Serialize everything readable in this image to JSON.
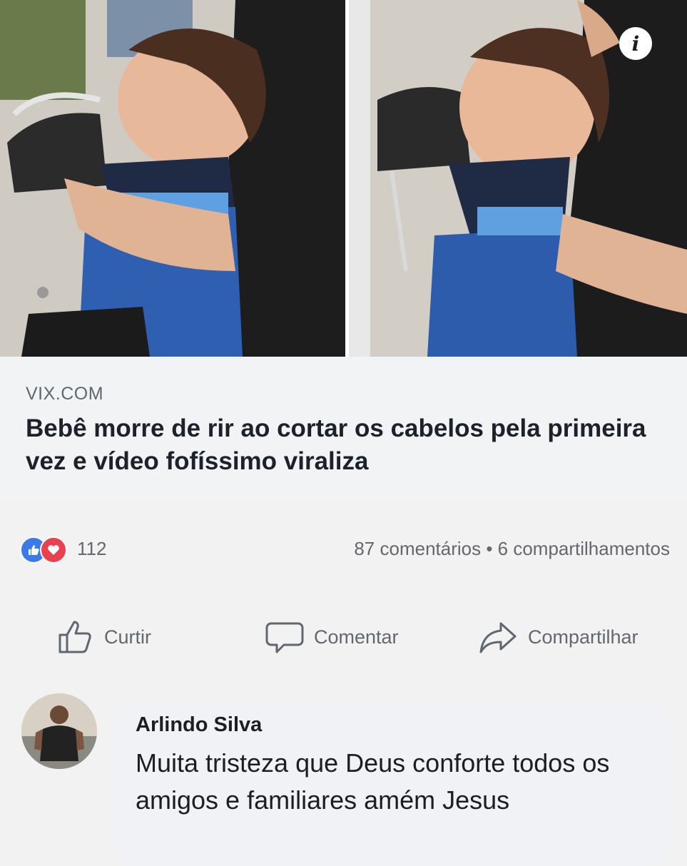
{
  "post": {
    "info_icon": "i",
    "source": "VIX.COM",
    "headline": "Bebê morre de rir ao cortar os cabelos pela primeira vez e vídeo fofíssimo viraliza",
    "reactions_count": "112",
    "comments_shares": "87 comentários • 6 compartilhamentos",
    "reaction_icons": [
      "like-icon",
      "love-icon"
    ]
  },
  "actions": {
    "like_label": "Curtir",
    "comment_label": "Comentar",
    "share_label": "Compartilhar"
  },
  "comment": {
    "author": "Arlindo Silva",
    "text": "Muita tristeza que Deus conforte todos os amigos e familiares amém Jesus"
  },
  "colors": {
    "like_blue": "#3b7be8",
    "love_red": "#e8414f",
    "muted_text": "#65676b"
  }
}
